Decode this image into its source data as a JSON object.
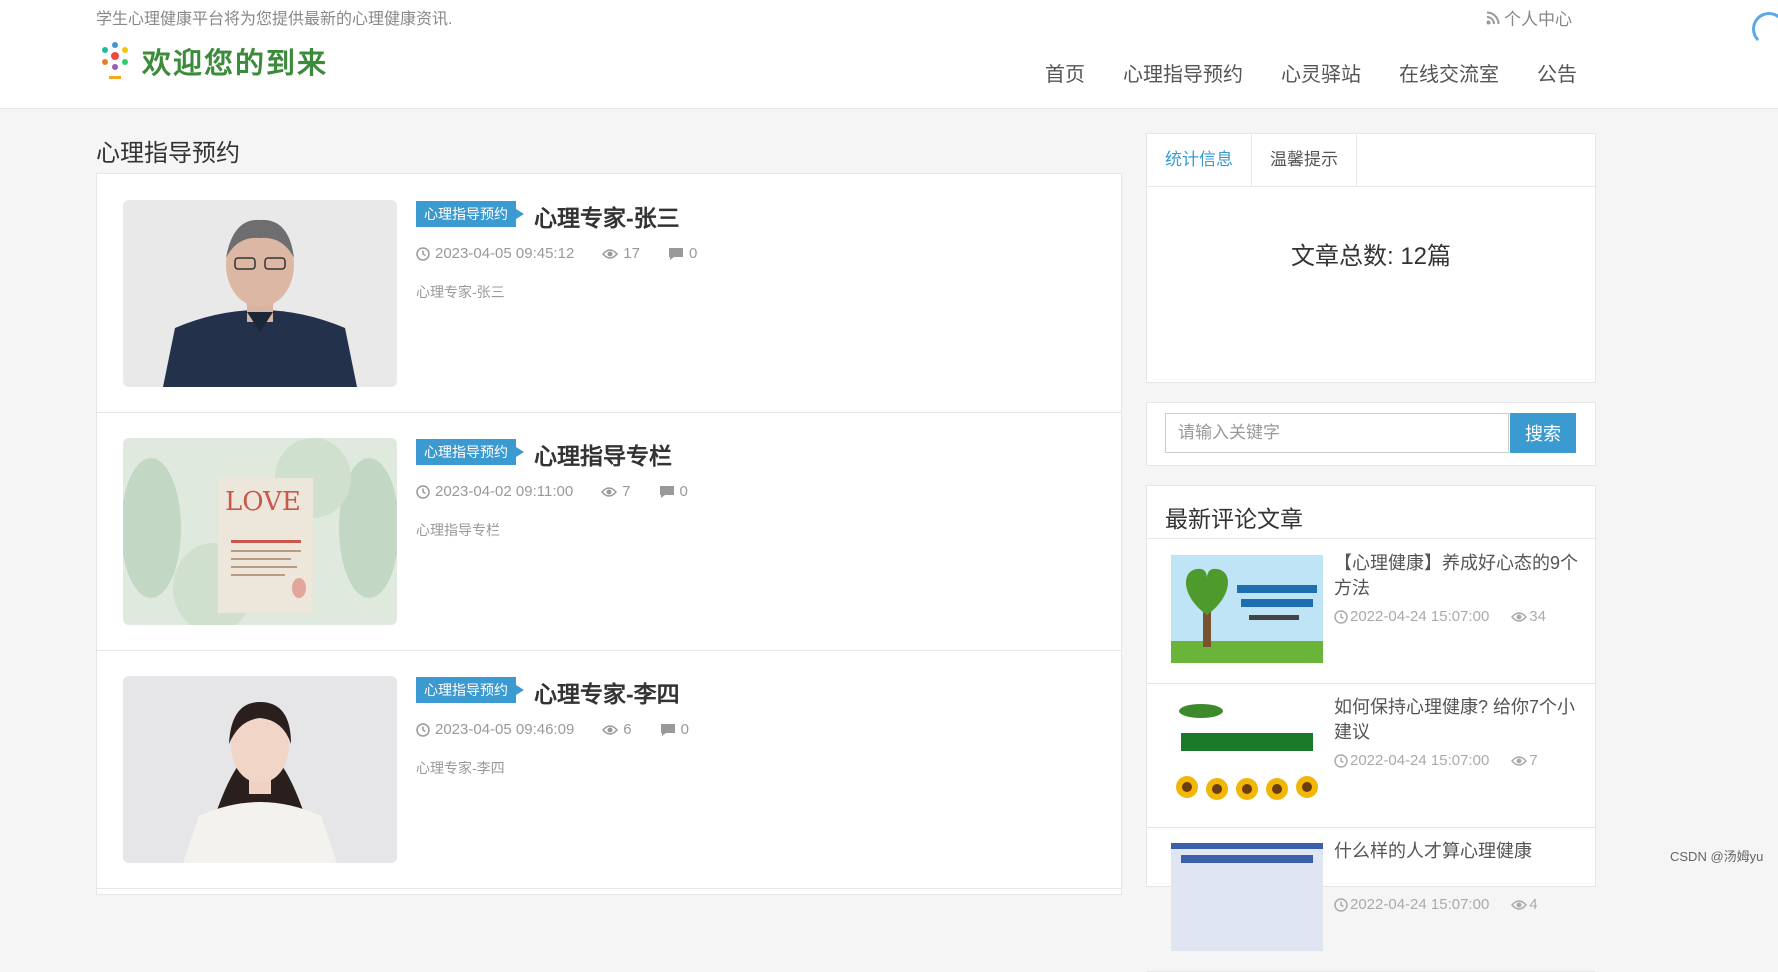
{
  "header": {
    "tagline": "学生心理健康平台将为您提供最新的心理健康资讯.",
    "user_center": "个人中心",
    "logo_text": "欢迎您的到来",
    "nav": [
      "首页",
      "心理指导预约",
      "心灵驿站",
      "在线交流室",
      "公告"
    ]
  },
  "main": {
    "section_title": "心理指导预约",
    "items": [
      {
        "badge": "心理指导预约",
        "title": "心理专家-张三",
        "date": "2023-04-05 09:45:12",
        "views": "17",
        "comments": "0",
        "excerpt": "心理专家-张三"
      },
      {
        "badge": "心理指导预约",
        "title": "心理指导专栏",
        "date": "2023-04-02 09:11:00",
        "views": "7",
        "comments": "0",
        "excerpt": "心理指导专栏"
      },
      {
        "badge": "心理指导预约",
        "title": "心理专家-李四",
        "date": "2023-04-05 09:46:09",
        "views": "6",
        "comments": "0",
        "excerpt": "心理专家-李四"
      }
    ]
  },
  "sidebar": {
    "tabs": [
      "统计信息",
      "温馨提示"
    ],
    "article_count": "文章总数: 12篇",
    "search": {
      "placeholder": "请输入关键字",
      "button": "搜索"
    },
    "recent_title": "最新评论文章",
    "recent": [
      {
        "title": "【心理健康】养成好心态的9个方法",
        "date": "2022-04-24 15:07:00",
        "views": "34"
      },
      {
        "title": "如何保持心理健康? 给你7个小建议",
        "date": "2022-04-24 15:07:00",
        "views": "7"
      },
      {
        "title": "什么样的人才算心理健康",
        "date": "2022-04-24 15:07:00",
        "views": "4"
      }
    ]
  },
  "watermark": "CSDN @汤姆yu",
  "colors": {
    "accent": "#3b9bd1",
    "logo_green": "#3c8b3a"
  }
}
